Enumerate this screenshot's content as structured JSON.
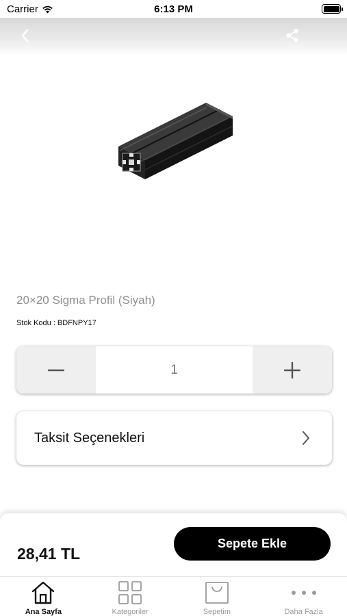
{
  "status_bar": {
    "carrier": "Carrier",
    "time": "6:13 PM"
  },
  "header": {
    "back_icon": "chevron-left-icon",
    "share_icon": "share-icon"
  },
  "product": {
    "title": "20×20 Sigma Profil (Siyah)",
    "stock_code": "Stok Kodu : BDFNPY17"
  },
  "quantity": {
    "value": "1",
    "decrement_icon": "minus-icon",
    "increment_icon": "plus-icon"
  },
  "installments": {
    "label": "Taksit Seçenekleri"
  },
  "purchase": {
    "price": "28,41 TL",
    "add_to_cart_label": "Sepete Ekle"
  },
  "tabs": [
    {
      "label": "Ana Sayfa",
      "icon": "home-icon",
      "active": true
    },
    {
      "label": "Kategoriler",
      "icon": "grid-icon",
      "active": false
    },
    {
      "label": "Sepetim",
      "icon": "shopping-bag-icon",
      "active": false
    },
    {
      "label": "Daha Fazla",
      "icon": "more-dots-icon",
      "active": false
    }
  ],
  "colors": {
    "accent": "#000000",
    "inactive_tab": "#9a9a9a",
    "muted_text": "#8f8f8f"
  }
}
